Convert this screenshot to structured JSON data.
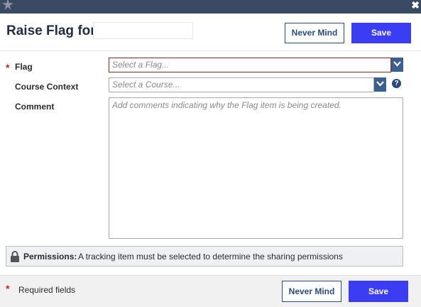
{
  "window": {
    "app_icon": "app-logo-icon",
    "close_icon": "close-icon",
    "close_glyph": "✖"
  },
  "header": {
    "title": "Raise Flag for",
    "never_mind_label": "Never Mind",
    "save_label": "Save"
  },
  "form": {
    "flag": {
      "label": "Flag",
      "required_mark": "*",
      "placeholder": "Select a Flag..."
    },
    "course_context": {
      "label": "Course Context",
      "placeholder": "Select a Course...",
      "help_glyph": "?"
    },
    "comment": {
      "label": "Comment",
      "placeholder": "Add comments indicating why the Flag item is being created."
    }
  },
  "permissions": {
    "label": "Permissions:",
    "text": "A tracking item must be selected to determine the sharing permissions",
    "icon": "lock-icon"
  },
  "footer": {
    "required_mark": "*",
    "required_text": "Required fields",
    "never_mind_label": "Never Mind",
    "save_label": "Save"
  },
  "colors": {
    "titlebar": "#3b4a63",
    "primary_button": "#3b3df5",
    "outline_button": "#2a4b7c",
    "required": "#c02525",
    "dropdown_button": "#3c5f8f"
  }
}
